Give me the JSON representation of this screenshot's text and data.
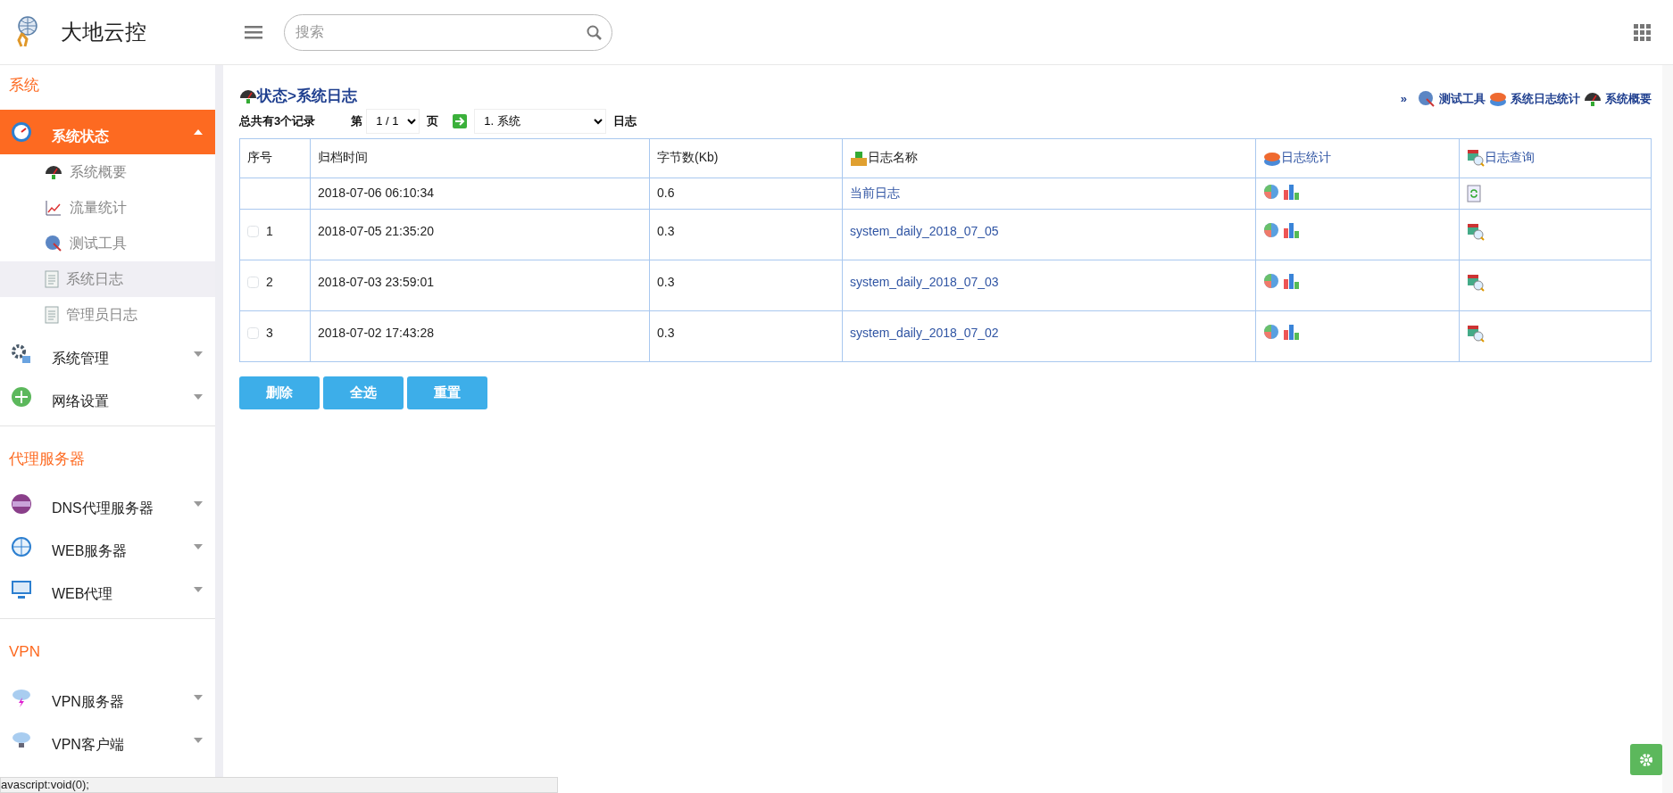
{
  "brand": {
    "title": "大地云控"
  },
  "search": {
    "placeholder": "搜索"
  },
  "sidebar": {
    "sections": [
      {
        "title": "系统",
        "items": [
          {
            "label": "系统状态",
            "selected": true,
            "expanded": true,
            "children": [
              {
                "label": "系统概要",
                "hovered": false
              },
              {
                "label": "流量统计",
                "hovered": false
              },
              {
                "label": "测试工具",
                "hovered": false
              },
              {
                "label": "系统日志",
                "hovered": true
              },
              {
                "label": "管理员日志",
                "hovered": false
              }
            ]
          },
          {
            "label": "系统管理",
            "selected": false,
            "expanded": false
          },
          {
            "label": "网络设置",
            "selected": false,
            "expanded": false
          }
        ]
      },
      {
        "title": "代理服务器",
        "items": [
          {
            "label": "DNS代理服务器",
            "selected": false,
            "expanded": false
          },
          {
            "label": "WEB服务器",
            "selected": false,
            "expanded": false
          },
          {
            "label": "WEB代理",
            "selected": false,
            "expanded": false
          }
        ]
      },
      {
        "title": "VPN",
        "items": [
          {
            "label": "VPN服务器",
            "selected": false,
            "expanded": false
          },
          {
            "label": "VPN客户端",
            "selected": false,
            "expanded": false
          }
        ]
      }
    ]
  },
  "breadcrumb": "状态>系统日志",
  "quick_links": {
    "prefix": "»",
    "links": [
      "测试工具",
      "系统日志统计",
      "系统概要"
    ]
  },
  "toolbar": {
    "record_count": "总共有3个记录",
    "page_prefix": "第",
    "page_select": "1 / 1",
    "page_suffix": "页",
    "log_select": "1. 系统",
    "log_suffix": "日志"
  },
  "table": {
    "columns": [
      "序号",
      "归档时间",
      "字节数(Kb)",
      "日志名称",
      "日志统计",
      "日志查询"
    ],
    "rows": [
      {
        "kind": "current",
        "index": "",
        "time": "2018-07-06 06:10:34",
        "size": "0.6",
        "name": "当前日志"
      },
      {
        "kind": "archive",
        "index": "1",
        "checked": false,
        "time": "2018-07-05 21:35:20",
        "size": "0.3",
        "name": "system_daily_2018_07_05"
      },
      {
        "kind": "archive",
        "index": "2",
        "checked": false,
        "time": "2018-07-03 23:59:01",
        "size": "0.3",
        "name": "system_daily_2018_07_03"
      },
      {
        "kind": "archive",
        "index": "3",
        "checked": false,
        "time": "2018-07-02 17:43:28",
        "size": "0.3",
        "name": "system_daily_2018_07_02"
      }
    ]
  },
  "buttons": [
    "删除",
    "全选",
    "重置"
  ],
  "status_bar": "avascript:void(0);"
}
